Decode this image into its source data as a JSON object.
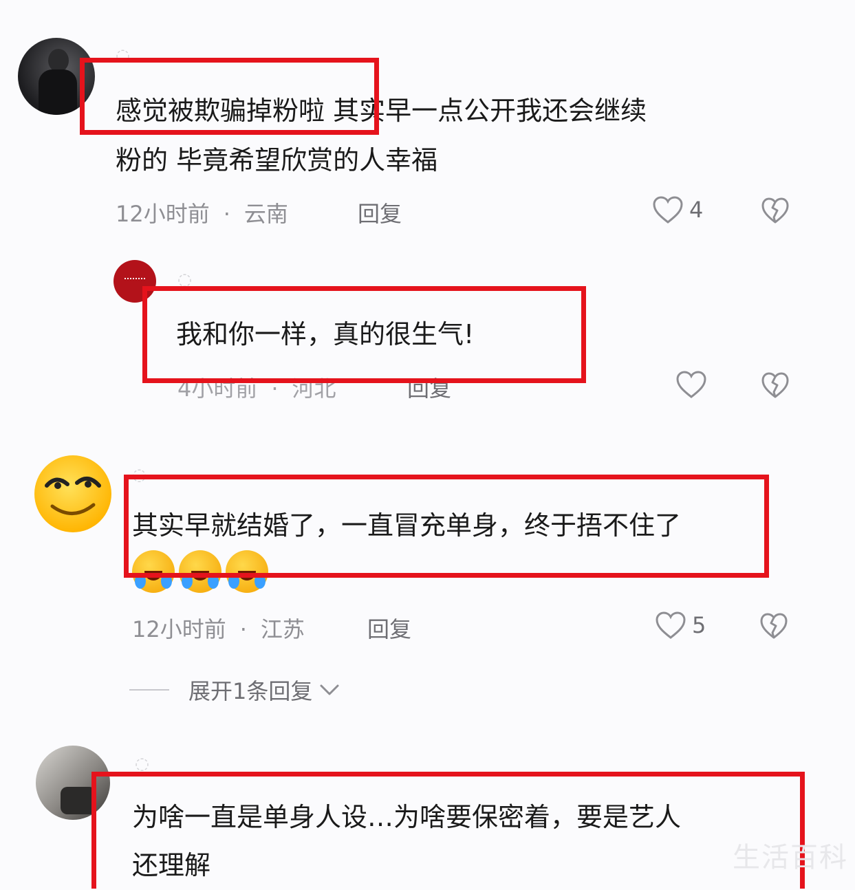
{
  "comments": [
    {
      "text_lines": [
        "感觉被欺骗掉粉啦 其实早一点公开我还会继续",
        "粉的 毕竟希望欣赏的人幸福"
      ],
      "time": "12小时前",
      "location": "云南",
      "reply_label": "回复",
      "likes": "4"
    },
    {
      "text_lines": [
        "我和你一样，真的很生气!"
      ],
      "time": "4小时前",
      "location": "河北",
      "reply_label": "回复",
      "likes": ""
    },
    {
      "text_lines": [
        "其实早就结婚了，一直冒充单身，终于捂不住了"
      ],
      "time": "12小时前",
      "location": "江苏",
      "reply_label": "回复",
      "likes": "5",
      "expand_label": "展开1条回复"
    },
    {
      "text_lines": [
        "为啥一直是单身人设…为啥要保密着，要是艺人",
        "还理解"
      ]
    }
  ],
  "separator": "·",
  "watermark": "生活百科",
  "colors": {
    "highlight_box": "#e5131c",
    "meta_text": "#8e8e93",
    "background": "#fbfbfd"
  },
  "icons": [
    "heart-outline-icon",
    "broken-heart-icon",
    "laugh-cry-emoji",
    "chevron-down-icon"
  ]
}
